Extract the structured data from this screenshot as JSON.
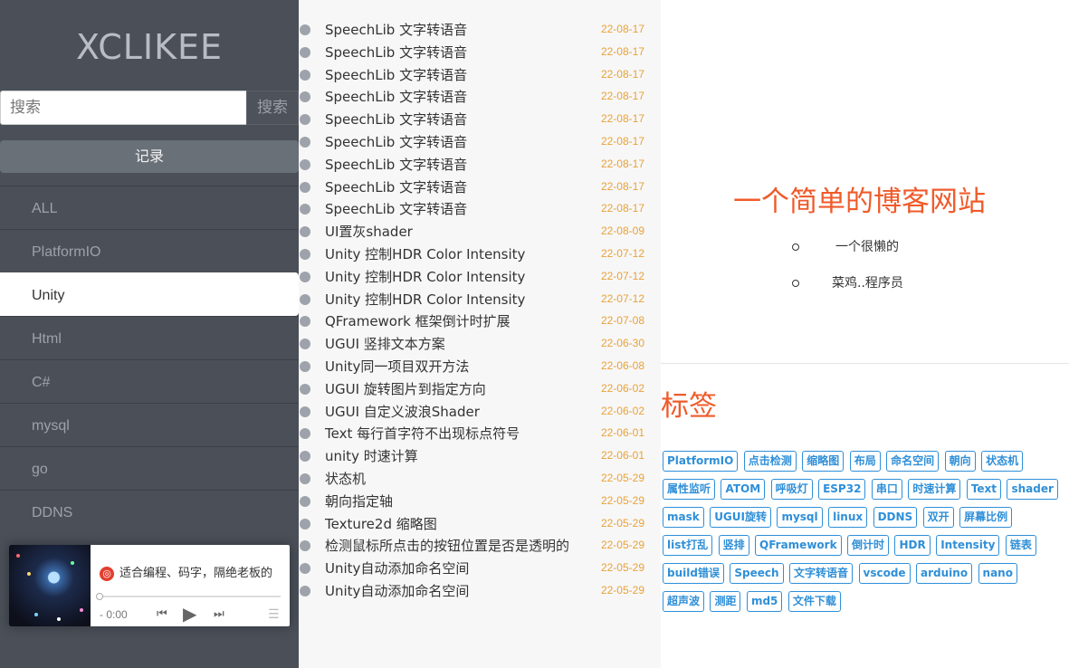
{
  "sidebar": {
    "logo": "XCLIKEE",
    "search_placeholder": "搜索",
    "search_button": "搜索",
    "record_button": "记录",
    "categories": [
      "ALL",
      "PlatformIO",
      "Unity",
      "Html",
      "C#",
      "mysql",
      "go",
      "DDNS"
    ],
    "active_category": "Unity"
  },
  "player": {
    "title": "适合编程、码字，隔绝老板的",
    "time": "- 0:00",
    "icons": [
      "netease-music-icon",
      "prev-icon",
      "play-icon",
      "next-icon",
      "playlist-icon"
    ]
  },
  "posts": [
    {
      "title": "SpeechLib 文字转语音",
      "date": "22-08-17"
    },
    {
      "title": "SpeechLib 文字转语音",
      "date": "22-08-17"
    },
    {
      "title": "SpeechLib 文字转语音",
      "date": "22-08-17"
    },
    {
      "title": "SpeechLib 文字转语音",
      "date": "22-08-17"
    },
    {
      "title": "SpeechLib 文字转语音",
      "date": "22-08-17"
    },
    {
      "title": "SpeechLib 文字转语音",
      "date": "22-08-17"
    },
    {
      "title": "SpeechLib 文字转语音",
      "date": "22-08-17"
    },
    {
      "title": "SpeechLib 文字转语音",
      "date": "22-08-17"
    },
    {
      "title": "SpeechLib 文字转语音",
      "date": "22-08-17"
    },
    {
      "title": "UI置灰shader",
      "date": "22-08-09"
    },
    {
      "title": "Unity 控制HDR Color Intensity",
      "date": "22-07-12"
    },
    {
      "title": "Unity 控制HDR Color Intensity",
      "date": "22-07-12"
    },
    {
      "title": "Unity 控制HDR Color Intensity",
      "date": "22-07-12"
    },
    {
      "title": "QFramework 框架倒计时扩展",
      "date": "22-07-08"
    },
    {
      "title": "UGUI 竖排文本方案",
      "date": "22-06-30"
    },
    {
      "title": "Unity同一项目双开方法",
      "date": "22-06-08"
    },
    {
      "title": "UGUI 旋转图片到指定方向",
      "date": "22-06-02"
    },
    {
      "title": "UGUI 自定义波浪Shader",
      "date": "22-06-02"
    },
    {
      "title": "Text 每行首字符不出现标点符号",
      "date": "22-06-01"
    },
    {
      "title": "unity 时速计算",
      "date": "22-06-01"
    },
    {
      "title": "状态机",
      "date": "22-05-29"
    },
    {
      "title": "朝向指定轴",
      "date": "22-05-29"
    },
    {
      "title": "Texture2d 缩略图",
      "date": "22-05-29"
    },
    {
      "title": "检测鼠标所点击的按钮位置是否是透明的",
      "date": "22-05-29"
    },
    {
      "title": "Unity自动添加命名空间",
      "date": "22-05-29"
    },
    {
      "title": "Unity自动添加命名空间",
      "date": "22-05-29"
    }
  ],
  "about": {
    "title": "一个简单的博客网站",
    "lines": [
      "一个很懒的",
      "菜鸡..程序员"
    ]
  },
  "tags_section": {
    "title": "标签",
    "tags": [
      "PlatformIO",
      "点击检测",
      "缩略图",
      "布局",
      "命名空间",
      "朝向",
      "状态机",
      "属性监听",
      "ATOM",
      "呼吸灯",
      "ESP32",
      "串口",
      "时速计算",
      "Text",
      "shader",
      "mask",
      "UGUI旋转",
      "mysql",
      "linux",
      "DDNS",
      "双开",
      "屏幕比例",
      "list打乱",
      "竖排",
      "QFramework",
      "倒计时",
      "HDR",
      "Intensity",
      "链表",
      "build错误",
      "Speech",
      "文字转语音",
      "vscode",
      "arduino",
      "nano",
      "超声波",
      "测距",
      "md5",
      "文件下载"
    ]
  }
}
